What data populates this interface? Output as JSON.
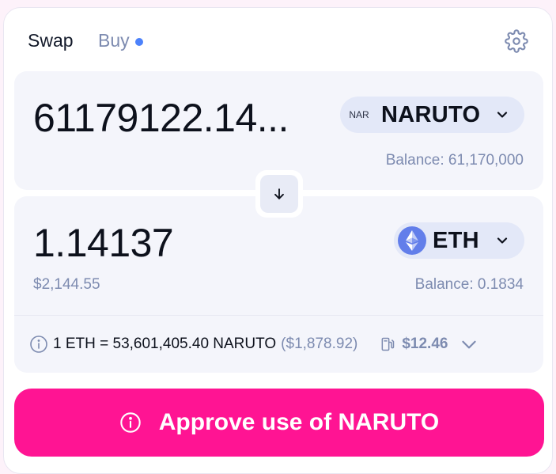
{
  "header": {
    "tabs": [
      {
        "label": "Swap",
        "active": true
      },
      {
        "label": "Buy",
        "active": false,
        "indicator_color": "#4c82fb"
      }
    ],
    "settings_icon": "gear-icon"
  },
  "input_panel": {
    "amount": "61179122.14...",
    "token": {
      "logo_text": "NAR",
      "symbol": "NARUTO"
    },
    "balance": "Balance: 61,170,000"
  },
  "switch_button": {
    "icon": "arrow-down-icon"
  },
  "output_panel": {
    "amount": "1.14137",
    "usd_value": "$2,144.55",
    "token": {
      "symbol": "ETH",
      "logo_icon": "ethereum-icon",
      "logo_color": "#627eea"
    },
    "balance": "Balance: 0.1834"
  },
  "rate_row": {
    "rate": "1 ETH = 53,601,405.40 NARUTO",
    "rate_usd": "($1,878.92)",
    "gas_icon": "gas-pump-icon",
    "gas_fee": "$12.46"
  },
  "approve_button": {
    "label": "Approve use of NARUTO",
    "color": "#ff1493"
  },
  "colors": {
    "accent": "#ff1493",
    "muted_text": "#7d8bb0",
    "panel_bg": "#f4f5fb"
  }
}
